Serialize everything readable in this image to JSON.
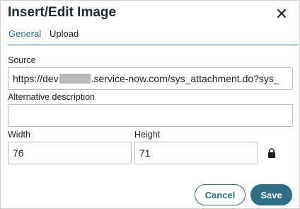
{
  "dialog": {
    "title": "Insert/Edit Image",
    "close_icon": "close-icon"
  },
  "tabs": [
    {
      "label": "General",
      "active": true
    },
    {
      "label": "Upload",
      "active": false
    }
  ],
  "form": {
    "source": {
      "label": "Source",
      "value_prefix": "https://dev",
      "value_suffix": ".service-now.com/sys_attachment.do?sys_"
    },
    "alt": {
      "label": "Alternative description",
      "value": ""
    },
    "width": {
      "label": "Width",
      "value": "76"
    },
    "height": {
      "label": "Height",
      "value": "71"
    },
    "constrain_icon": "lock-icon"
  },
  "buttons": {
    "cancel": "Cancel",
    "save": "Save"
  },
  "colors": {
    "accent": "#2f6e85",
    "border": "#bdbdbd",
    "redaction": "#b9b9b9"
  }
}
